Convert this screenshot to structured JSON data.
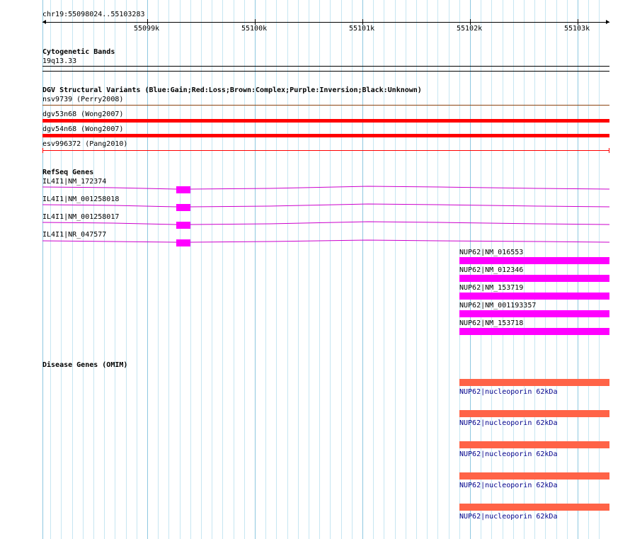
{
  "ruler": {
    "location": "chr19:55098024..55103283",
    "ticks": [
      "55099k",
      "55100k",
      "55101k",
      "55102k",
      "55103k"
    ]
  },
  "tracks": {
    "cytoband": {
      "title": "Cytogenetic Bands",
      "band": "19q13.33"
    },
    "dgv": {
      "title": "DGV Structural Variants (Blue:Gain;Red:Loss;Brown:Complex;Purple:Inversion;Black:Unknown)",
      "items": [
        {
          "label": "nsv9739 (Perry2008)",
          "type": "complex"
        },
        {
          "label": "dgv53n68 (Wong2007)",
          "type": "loss"
        },
        {
          "label": "dgv54n68 (Wong2007)",
          "type": "loss"
        },
        {
          "label": "esv996372 (Pang2010)",
          "type": "loss"
        }
      ]
    },
    "refseq": {
      "title": "RefSeq Genes",
      "il4i1": [
        {
          "label": "IL4I1|NM_172374"
        },
        {
          "label": "IL4I1|NM_001258018"
        },
        {
          "label": "IL4I1|NM_001258017"
        },
        {
          "label": "IL4I1|NR_047577"
        }
      ],
      "nup62": [
        {
          "label": "NUP62|NM_016553"
        },
        {
          "label": "NUP62|NM_012346"
        },
        {
          "label": "NUP62|NM_153719"
        },
        {
          "label": "NUP62|NM_001193357"
        },
        {
          "label": "NUP62|NM_153718"
        }
      ]
    },
    "omim": {
      "title": "Disease Genes (OMIM)",
      "items": [
        {
          "label": "NUP62|nucleoporin 62kDa"
        },
        {
          "label": "NUP62|nucleoporin 62kDa"
        },
        {
          "label": "NUP62|nucleoporin 62kDa"
        },
        {
          "label": "NUP62|nucleoporin 62kDa"
        },
        {
          "label": "NUP62|nucleoporin 62kDa"
        }
      ]
    }
  },
  "colors": {
    "grid_minor": "#c6e6f2",
    "grid_major": "#8ec8e0",
    "dgv_loss": "#ff0000",
    "dgv_complex": "#8b4513",
    "refseq_gene": "#ff00ff",
    "refseq_intron": "#cc00cc",
    "omim_gene": "#ff6347",
    "omim_label": "#00008b"
  }
}
